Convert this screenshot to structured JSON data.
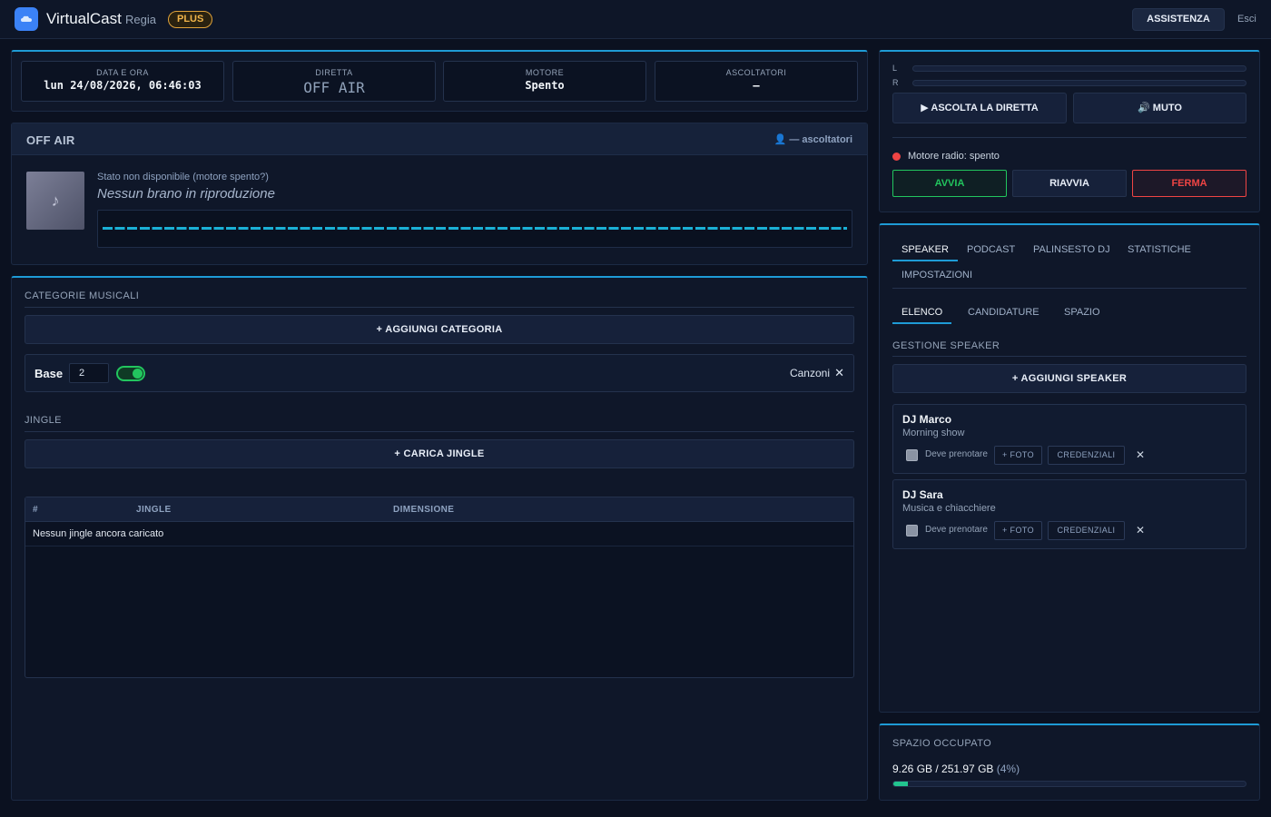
{
  "header": {
    "app_name": "VirtualCast",
    "app_sub": "Regia",
    "badge": "PLUS",
    "assist_label": "ASSISTENZA",
    "exit_label": "Esci"
  },
  "stats": [
    {
      "label": "DATA E ORA",
      "value": "lun 24/08/2026, 06:46:03"
    },
    {
      "label": "DIRETTA",
      "value": "OFF AIR"
    },
    {
      "label": "MOTORE",
      "value": "Spento"
    },
    {
      "label": "ASCOLTATORI",
      "value": "—"
    }
  ],
  "now_playing": {
    "title": "OFF AIR",
    "listeners": "👤 — ascoltatori",
    "status": "Stato non disponibile (motore spento?)",
    "track": "Nessun brano in riproduzione",
    "cover_icon": "♪"
  },
  "categories": {
    "title": "CATEGORIE MUSICALI",
    "add_label": "+ AGGIUNGI CATEGORIA",
    "items": [
      {
        "name": "Base",
        "weight": "2",
        "enabled": true,
        "type": "Canzoni",
        "delete_icon": "✕"
      }
    ]
  },
  "jingles": {
    "title": "JINGLE",
    "upload_label": "+ CARICA JINGLE",
    "columns": [
      "#",
      "JINGLE",
      "DIMENSIONE"
    ],
    "empty_text": "Nessun jingle ancora caricato"
  },
  "player": {
    "meter_left": "L",
    "meter_right": "R",
    "listen_label": "▶ ASCOLTA LA DIRETTA",
    "mute_label": "🔊 MUTO",
    "engine_status": "Motore radio: spento",
    "start_label": "AVVIA",
    "restart_label": "RIAVVIA",
    "stop_label": "FERMA",
    "colors": {
      "start": "#22c55e",
      "stop": "#ef4444",
      "status_dot": "#ef4444"
    }
  },
  "tabs": {
    "main": [
      "SPEAKER",
      "PODCAST",
      "PALINSESTO DJ",
      "STATISTICHE",
      "IMPOSTAZIONI"
    ],
    "sub": [
      "ELENCO",
      "CANDIDATURE",
      "SPAZIO"
    ]
  },
  "speakers": {
    "title": "GESTIONE SPEAKER",
    "add_label": "+ AGGIUNGI SPEAKER",
    "must_book_label": "Deve prenotare",
    "photo_label": "+ FOTO",
    "credentials_label": "CREDENZIALI",
    "delete_icon": "✕",
    "items": [
      {
        "name": "DJ Marco",
        "desc": "Morning show"
      },
      {
        "name": "DJ Sara",
        "desc": "Musica e chiacchiere"
      }
    ]
  },
  "storage": {
    "title": "SPAZIO OCCUPATO",
    "value": "9.26 GB / 251.97 GB",
    "percent_label": "(4%)",
    "fraction": 0.04,
    "accent": "#22c58f"
  }
}
